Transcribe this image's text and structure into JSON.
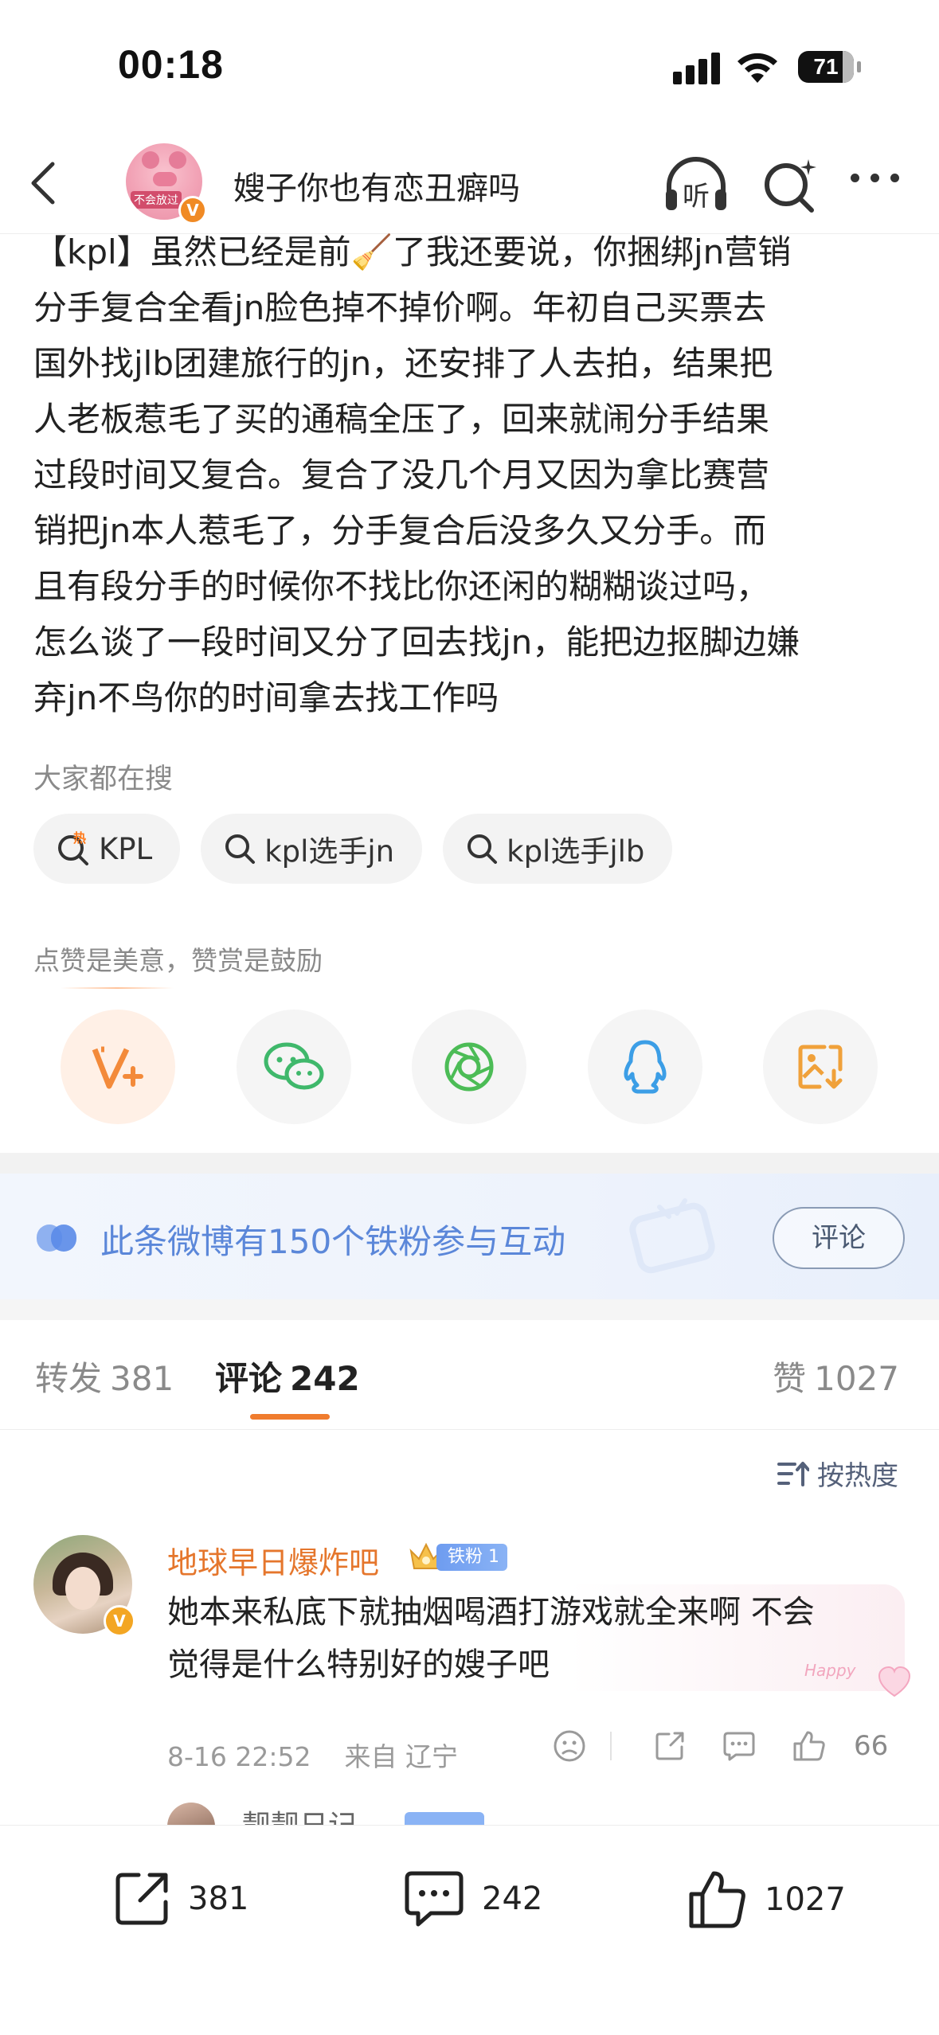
{
  "status_bar": {
    "time": "00:18",
    "battery": "71"
  },
  "nav": {
    "title": "嫂子你也有恋丑癖吗",
    "avatar_tag": "不会放过",
    "verified_mark": "V",
    "listen_label": "听"
  },
  "post": {
    "lines": [
      "【kpl】虽然已经是前🧹了我还要说，你捆绑jn营销",
      "分手复合全看jn脸色掉不掉价啊。年初自己买票去",
      "国外找jlb团建旅行的jn，还安排了人去拍，结果把",
      "人老板惹毛了买的通稿全压了，回来就闹分手结果",
      "过段时间又复合。复合了没几个月又因为拿比赛营",
      "销把jn本人惹毛了，分手复合后没多久又分手。而",
      "且有段分手的时候你不找比你还闲的糊糊谈过吗，",
      "怎么谈了一段时间又分了回去找jn，能把边抠脚边嫌",
      "弃jn不鸟你的时间拿去找工作吗"
    ]
  },
  "search": {
    "title": "大家都在搜",
    "chips": [
      {
        "hot_mark": "热",
        "label": "KPL"
      },
      {
        "label": "kpl选手jn"
      },
      {
        "label": "kpl选手jlb"
      }
    ]
  },
  "praise": {
    "title": "点赞是美意，赞赏是鼓励",
    "buttons": [
      "reward-icon",
      "wechat-icon",
      "moments-icon",
      "qq-icon",
      "save-image-icon"
    ]
  },
  "fans_banner": {
    "text": "此条微博有150个铁粉参与互动",
    "button": "评论"
  },
  "tabs": {
    "repost_label": "转发",
    "repost_count": "381",
    "comment_label": "评论",
    "comment_count": "242",
    "like_label": "赞",
    "like_count": "1027"
  },
  "sort_label": "按热度",
  "comments": [
    {
      "name": "地球早日爆炸吧",
      "fan_badge": "铁粉 1",
      "text_lines": [
        "她本来私底下就抽烟喝酒打游戏就全来啊 不会",
        "觉得是什么特别好的嫂子吧"
      ],
      "bubble_deco": "Happy",
      "time": "8-16 22:52",
      "source": "来自 辽宁",
      "like_count": "66"
    },
    {
      "name": "靓靓日记"
    }
  ],
  "bottom_bar": {
    "repost": "381",
    "comment": "242",
    "like": "1027"
  },
  "colors": {
    "accent": "#f07c2e",
    "name_orange": "#e5762c",
    "fans_blue": "#5b87d9"
  }
}
